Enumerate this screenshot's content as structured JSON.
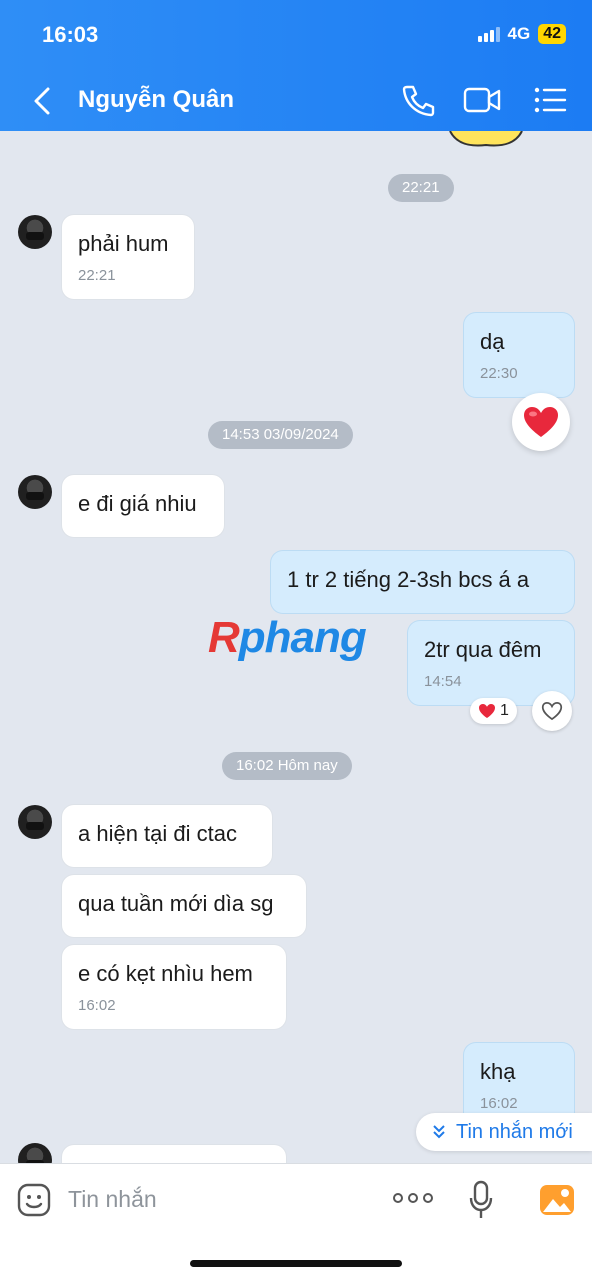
{
  "status_bar": {
    "time": "16:03",
    "network": "4G",
    "battery": "42"
  },
  "header": {
    "contact_name": "Nguyễn Quân"
  },
  "colors": {
    "header": "#1c7cf3",
    "chat_bg": "#e2e7ef",
    "outgoing_bubble": "#d5ecfd",
    "incoming_bubble": "#ffffff",
    "accent": "#1f7ae8"
  },
  "chat": {
    "separators": [
      "22:21",
      "14:53 03/09/2024",
      "16:02 Hôm nay"
    ],
    "messages": [
      {
        "dir": "in",
        "text": "phải hum",
        "time": "22:21"
      },
      {
        "dir": "out",
        "text": "dạ",
        "time": "22:30"
      },
      {
        "dir": "in",
        "text": "e đi giá nhiu",
        "time": ""
      },
      {
        "dir": "out",
        "text": "1 tr 2 tiếng 2-3sh bcs á a",
        "time": ""
      },
      {
        "dir": "out",
        "text": "2tr qua đêm",
        "time": "14:54"
      },
      {
        "dir": "in",
        "text": "a hiện tại đi ctac",
        "time": ""
      },
      {
        "dir": "in",
        "text": "qua tuần mới dìa sg",
        "time": ""
      },
      {
        "dir": "in",
        "text": "e có kẹt nhìu hem",
        "time": "16:02"
      },
      {
        "dir": "out",
        "text": "khạ",
        "time": "16:02"
      }
    ],
    "reaction_count": "1",
    "watermark": {
      "first": "R",
      "rest": "phang"
    },
    "new_messages_label": "Tin nhắn mới"
  },
  "input": {
    "placeholder": "Tin nhắn"
  }
}
